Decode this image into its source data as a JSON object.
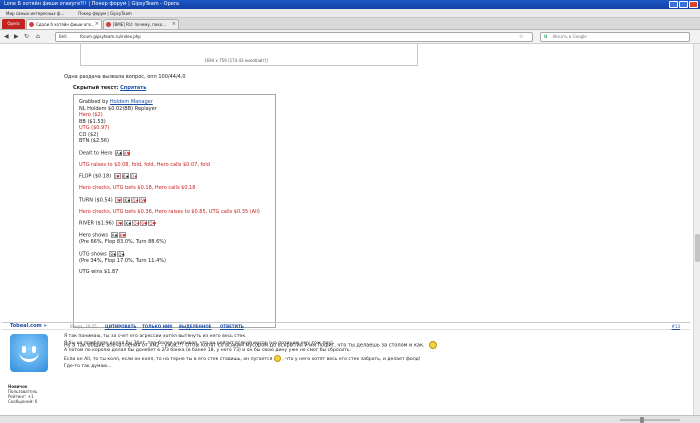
{
  "window": {
    "title": "Lone Б хотяйн фиши огвиуге?!! | Покер форум | GipsyTeam - Opera"
  },
  "bookmarks": [
    "Мир самых интересных ф...",
    "Покер форум | GipsyTeam"
  ],
  "tabs": {
    "opera_label": "Opera",
    "items": [
      {
        "label": "Сдали б хотяйн фиши огв..."
      },
      {
        "label": "[ВМЕ] RU: почему, поко..."
      }
    ]
  },
  "nav": {
    "web_label": "Веб",
    "url": "forum.gipsyteam.ru/index.php",
    "search_placeholder": "Искать в Google"
  },
  "post_image": {
    "caption": "[694 x 759 (174.43 килобайт)]"
  },
  "question_line": "Одна раздача вызвала вопрос, опп 100/44/4,0",
  "hidden": {
    "label": "Скрытый текст:",
    "hide_link": "Спрятать"
  },
  "hand": {
    "grabbed_prefix": "Grabbed by",
    "grabbed_link": "Holdem Manager",
    "game": "NL Holdem $0.02(BB) Replayer",
    "positions": [
      "Hero ($2)",
      "BB ($1.53)",
      "UTG ($0.97)",
      "CO ($2)",
      "BTN ($2.56)"
    ],
    "dealt": "Dealt to Hero",
    "dealt_cards": [
      "A♣",
      "K♥"
    ],
    "preflop_action": "UTG raises to $0.08, fold, fold, Hero calls $0.07, fold",
    "flop": "FLOP ($0.18)",
    "flop_cards": [
      "J♥",
      "K♠",
      "Q♦"
    ],
    "flop_action": "Hero checks, UTG bets $0.18, Hero calls $0.18",
    "turn": "TURN ($0.54)",
    "turn_cards": [
      "J♥",
      "K♠",
      "Q♦",
      "6♥"
    ],
    "turn_action": "Hero checks, UTG bets $0.36, Hero raises to $0.85, UTG calls $0.35 (All)",
    "river": "RIVER ($1.96)",
    "river_cards": [
      "J♥",
      "K♠",
      "Q♦",
      "6♥",
      "Q♥"
    ],
    "hero_shows": "Hero shows",
    "hero_cards": [
      "A♣",
      "K♥"
    ],
    "hero_equity": "(Pre 66%, Flop 83.0%, Turn 88.6%)",
    "utg_shows": "UTG shows",
    "utg_cards": [
      "8♠",
      "Q♠"
    ],
    "utg_equity": "(Pre 34%, Flop 17.0%, Turn 11.4%)",
    "utg_wins": "UTG wins $1.87"
  },
  "comment": "Ну а так общие впечатления от хм2 - ужас!!! Отпы копят со всяким мусором до вскрытия и им пофиг, что ты делаешь за столом и как.",
  "reply": {
    "nick": "Tobeal.com »",
    "date": "Вчера, 10:25",
    "actions": [
      "ЦИТИРОВАТЬ",
      "ТОЛЬКО НИК",
      "ВЫДЕЛЕННОЕ",
      "ОТВЕТИТЬ"
    ],
    "post_num": "#13",
    "user_title": "Новичок",
    "user_group": "Пользователь",
    "rating": "Рейтинг: +1",
    "messages": "Сообщений: 6",
    "body": [
      "Я так понимаю, ты за счет его агрессии хотел вытянуть из него весь стек.",
      "Я бы на префлопе делал бы 3бет, тем более учитывая, что он рейзит всякий мусор (на позицию ему тож пох).",
      "А потом по королю делал бы донкбет в 2/3 банка (в банке 18, у него 73) и он бы свою дину уже не смог бы сбросить.",
      "Если он All, то ты колл, если он колл, то на терне ты в его стек ставишь, он пугается",
      ", что у него хотят весь его стек забрать, и делает фолд!",
      "Где-то так думаю..."
    ]
  }
}
